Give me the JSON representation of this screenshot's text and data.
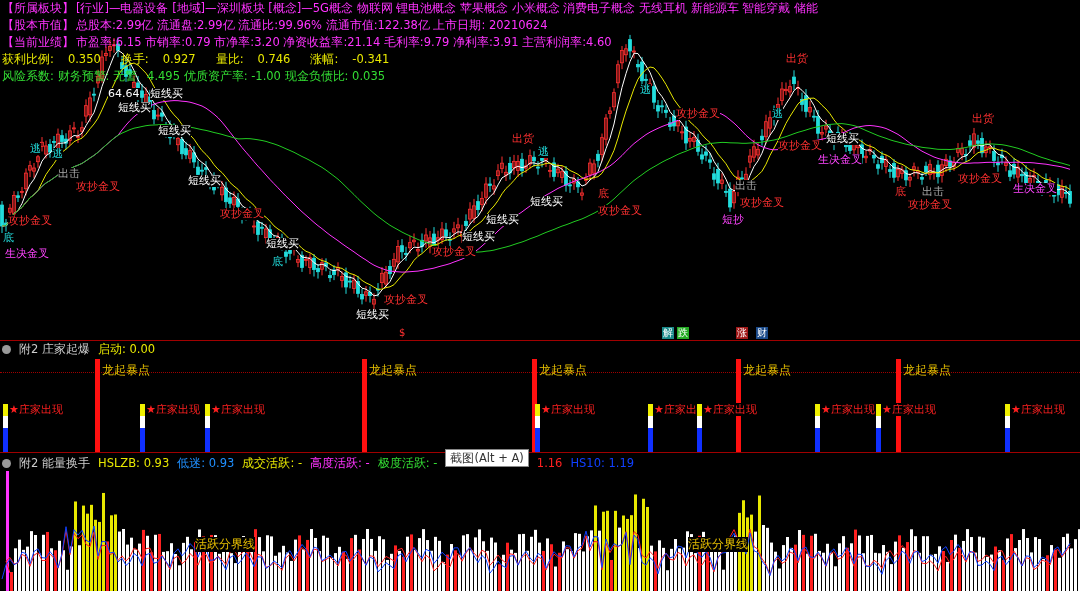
{
  "main_chart": {
    "info_rows": [
      {
        "label": "【所属板块】",
        "value": "[行业]—电器设备 [地域]—深圳板块 [概念]—5G概念 物联网 锂电池概念 苹果概念 小米概念 消费电子概念 无线耳机 新能源车 智能穿戴 储能"
      },
      {
        "label": "【股本市值】",
        "value": "总股本:2.99亿 流通盘:2.99亿 流通比:99.96% 流通市值:122.38亿 上市日期: 20210624"
      },
      {
        "label": "【当前业绩】",
        "value": "市盈率:6.15 市销率:0.79 市净率:3.20 净资收益率:21.14 毛利率:9.79 净利率:3.91 主营利润率:4.60"
      }
    ],
    "metrics": [
      {
        "label": "获利比例:",
        "value": "0.350"
      },
      {
        "label": "换手:",
        "value": "0.927"
      },
      {
        "label": "量比:",
        "value": "0.746"
      },
      {
        "label": "涨幅:",
        "value": "-0.341"
      }
    ],
    "risk_texts": [
      "风险系数: 财务预警: 无警",
      "4.495 优质资产率: -1.00 现金负债比: 0.035"
    ],
    "signals": [
      {
        "text": "64.64",
        "kind": "price"
      },
      {
        "text": "短线买",
        "kind": "buy"
      },
      {
        "text": "短线买",
        "kind": "buy"
      },
      {
        "text": "逃",
        "kind": "escape"
      },
      {
        "text": "逃",
        "kind": "escape"
      },
      {
        "text": "出击",
        "kind": "strike"
      },
      {
        "text": "攻抄金叉",
        "kind": "cross"
      },
      {
        "text": "短线买",
        "kind": "buy"
      },
      {
        "text": "短线买",
        "kind": "buy"
      },
      {
        "text": "攻抄金叉",
        "kind": "cross"
      },
      {
        "text": "攻抄金叉",
        "kind": "cross"
      },
      {
        "text": "底",
        "kind": "bottom"
      },
      {
        "text": "生决金叉",
        "kind": "life"
      },
      {
        "text": "短线买",
        "kind": "buy"
      },
      {
        "text": "底",
        "kind": "bottom"
      },
      {
        "text": "攻抄金叉",
        "kind": "cross"
      },
      {
        "text": "短线买",
        "kind": "buy"
      },
      {
        "text": "短线买",
        "kind": "buy"
      },
      {
        "text": "攻抄金叉",
        "kind": "cross"
      },
      {
        "text": "短线买",
        "kind": "buy"
      },
      {
        "text": "出货",
        "kind": "sell"
      },
      {
        "text": "逃",
        "kind": "escape"
      },
      {
        "text": "短线买",
        "kind": "buy"
      },
      {
        "text": "底",
        "kind": "sell"
      },
      {
        "text": "攻抄金叉",
        "kind": "cross"
      },
      {
        "text": "逃",
        "kind": "escape"
      },
      {
        "text": "攻抄金叉",
        "kind": "cross"
      },
      {
        "text": "出击",
        "kind": "strike"
      },
      {
        "text": "攻抄金叉",
        "kind": "cross"
      },
      {
        "text": "短抄",
        "kind": "life"
      },
      {
        "text": "出货",
        "kind": "sell"
      },
      {
        "text": "逃",
        "kind": "escape"
      },
      {
        "text": "攻抄金叉",
        "kind": "cross"
      },
      {
        "text": "短线买",
        "kind": "buy"
      },
      {
        "text": "生决金叉",
        "kind": "life"
      },
      {
        "text": "底",
        "kind": "sell"
      },
      {
        "text": "出击",
        "kind": "strike"
      },
      {
        "text": "攻抄金叉",
        "kind": "cross"
      },
      {
        "text": "出货",
        "kind": "sell"
      },
      {
        "text": "攻抄金叉",
        "kind": "cross"
      },
      {
        "text": "生决金叉",
        "kind": "life"
      }
    ],
    "badges": [
      {
        "text": "$",
        "kind": "dollar"
      },
      {
        "text": "解",
        "kind": "unlock"
      },
      {
        "text": "跌",
        "kind": "fall"
      },
      {
        "text": "涨",
        "kind": "rise"
      },
      {
        "text": "财",
        "kind": "finance"
      }
    ]
  },
  "dealer_panel": {
    "title": "附2 庄家起爆",
    "reading": "启动: 0.00",
    "events": [
      {
        "kind": "dealer",
        "text": "★庄家出现"
      },
      {
        "kind": "burst",
        "text": "龙起暴点"
      },
      {
        "kind": "dealer",
        "text": "★庄家出现"
      },
      {
        "kind": "dealer",
        "text": "★庄家出现"
      },
      {
        "kind": "burst",
        "text": "龙起暴点"
      },
      {
        "kind": "burst",
        "text": "龙起暴点"
      },
      {
        "kind": "dealer",
        "text": "★庄家出现"
      },
      {
        "kind": "dealer",
        "text": "★庄家出"
      },
      {
        "kind": "dealer",
        "text": "★庄家出现"
      },
      {
        "kind": "burst",
        "text": "龙起暴点"
      },
      {
        "kind": "dealer",
        "text": "★庄家出现"
      },
      {
        "kind": "dealer",
        "text": "★庄家出现"
      },
      {
        "kind": "burst",
        "text": "龙起暴点"
      },
      {
        "kind": "dealer",
        "text": "★庄家出现"
      }
    ]
  },
  "volume_panel": {
    "title": "附2 能量换手",
    "readings": [
      {
        "text": "HSLZB: 0.93",
        "kind": "level"
      },
      {
        "text": "低迷: 0.93",
        "kind": "low"
      },
      {
        "text": "成交活跃: -",
        "kind": "active"
      },
      {
        "text": "高度活跃: -",
        "kind": "high"
      },
      {
        "text": "极度活跃: -",
        "kind": "extreme"
      },
      {
        "text": "1.16",
        "kind": "hs5"
      },
      {
        "text": "HS10: 1.19",
        "kind": "hs10"
      }
    ],
    "line_labels": [
      "活跃分界线",
      "活跃分界线"
    ]
  },
  "tooltip": {
    "text": "截图(Alt + A)"
  }
}
